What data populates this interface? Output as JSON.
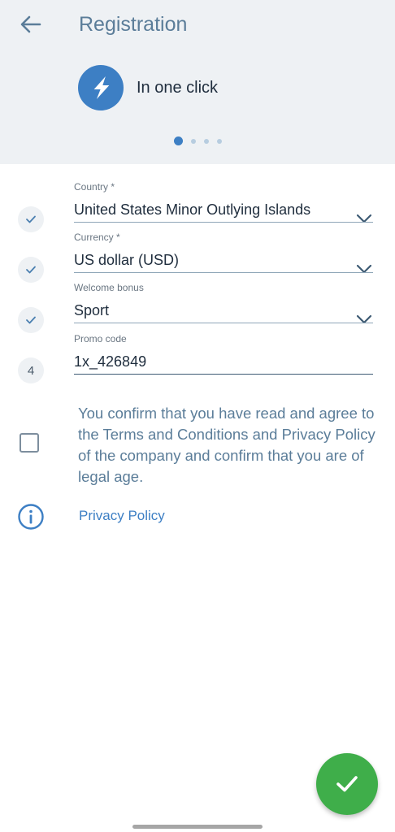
{
  "header": {
    "title": "Registration",
    "registration_type_label": "In one click",
    "steps_total": 4,
    "active_step": 1
  },
  "form": {
    "fields": [
      {
        "step": "✓",
        "label": "Country *",
        "value": "United States Minor Outlying Islands",
        "dropdown": true
      },
      {
        "step": "✓",
        "label": "Currency *",
        "value": "US dollar (USD)",
        "dropdown": true
      },
      {
        "step": "✓",
        "label": "Welcome bonus",
        "value": "Sport",
        "dropdown": true
      },
      {
        "step": "4",
        "label": "Promo code",
        "value": "1x_426849",
        "dropdown": false
      }
    ],
    "agreement_text": "You confirm that you have read and agree to the Terms and Conditions and Privacy Policy of the company and confirm that you are of legal age.",
    "agreement_checked": false,
    "privacy_link": "Privacy Policy"
  },
  "colors": {
    "accent": "#3d7fc4",
    "confirm_button": "#3fae4a",
    "header_bg": "#eef1f4"
  },
  "icons": {
    "back": "arrow-left-icon",
    "registration_type": "lightning-icon",
    "completed_step": "check-icon",
    "info": "info-icon",
    "confirm": "check-icon"
  }
}
